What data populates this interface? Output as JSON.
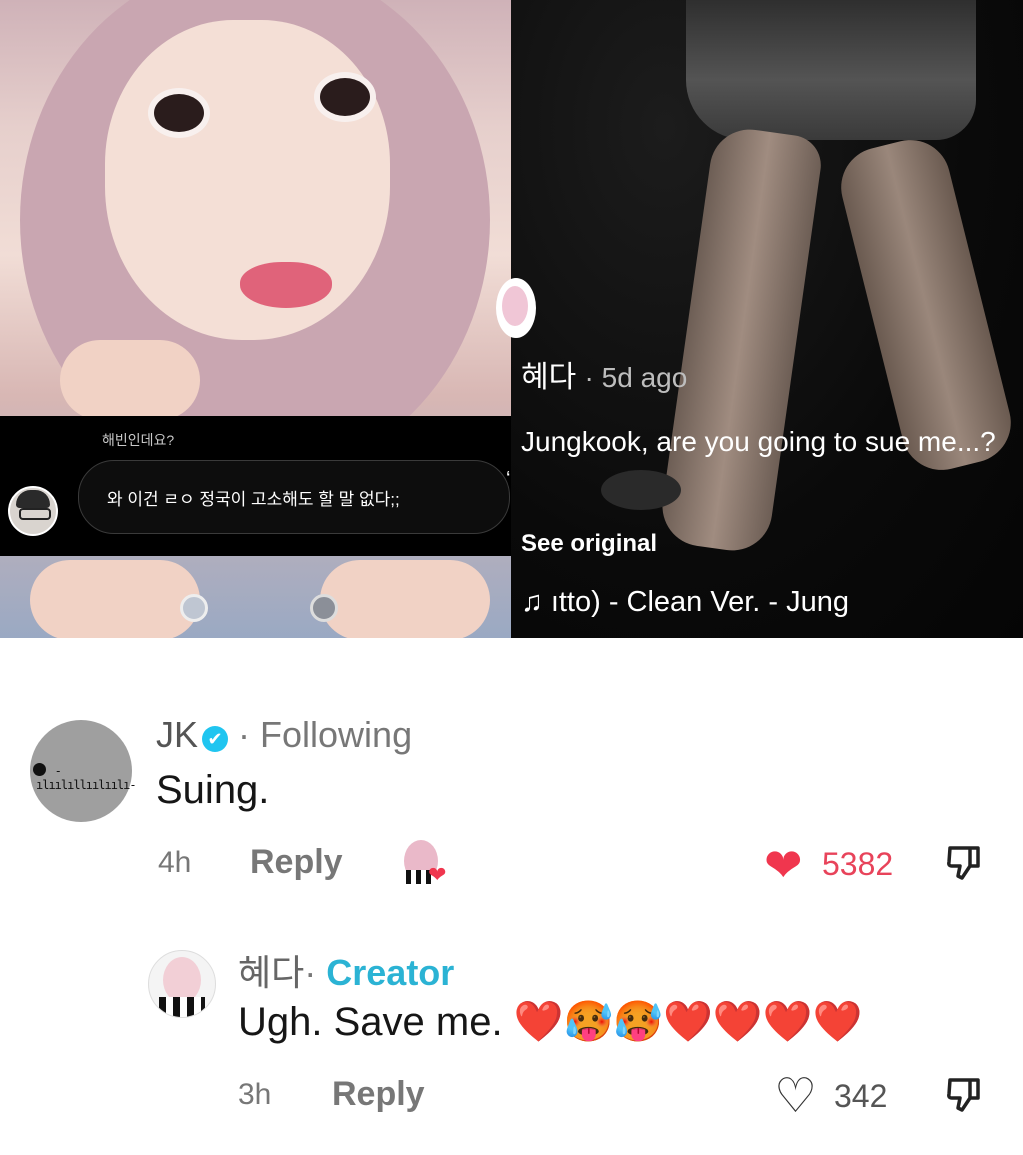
{
  "video_left": {
    "comment_username": "해빈인데요?",
    "comment_text": "와 이건 ㄹㅇ 정국이 고소해도 할 말 없다;;"
  },
  "video_right": {
    "author": "혜다",
    "age": "· 5d ago",
    "caption": "Jungkook, are you going to sue me...?",
    "see_original": "See original",
    "music_icon": "music-note-icon",
    "music_glyph": "♫",
    "music_text": "ıtto) - Clean Ver. - Jung"
  },
  "comments": [
    {
      "author": "JK",
      "author_suffix": "· Following",
      "verified_glyph": "✔",
      "text": "Suing.",
      "time": "4h",
      "reply_label": "Reply",
      "likes": "5382",
      "liked": true,
      "like_color": "#f0364e",
      "heart_glyph": "❤"
    },
    {
      "author": "혜다",
      "author_suffix": "·",
      "badge": "Creator",
      "text": "Ugh. Save me. ❤️🥵🥵❤️❤️❤️❤️",
      "time": "3h",
      "reply_label": "Reply",
      "likes": "342",
      "liked": false,
      "heart_glyph": "♡"
    }
  ],
  "colors": {
    "creator_badge": "#2bb3d4",
    "verified": "#20c5f0"
  }
}
